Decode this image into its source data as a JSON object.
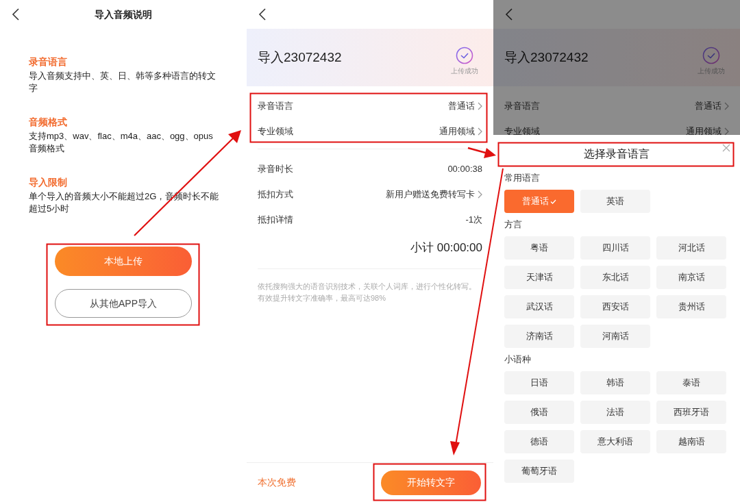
{
  "import_guide": {
    "title": "导入音频说明",
    "sections": [
      {
        "heading": "录音语言",
        "body": "导入音频支持中、英、日、韩等多种语言的转文字"
      },
      {
        "heading": "音频格式",
        "body": "支持mp3、wav、flac、m4a、aac、ogg、opus音频格式"
      },
      {
        "heading": "导入限制",
        "body": "单个导入的音频大小不能超过2G，音频时长不能超过5小时"
      }
    ],
    "buttons": [
      {
        "label": "本地上传",
        "kind": "primary"
      },
      {
        "label": "从其他APP导入",
        "kind": "outline"
      }
    ]
  },
  "import_detail": {
    "title": "导入23072432",
    "status": "上传成功",
    "settings": [
      {
        "label": "录音语言",
        "value": "普通话",
        "has_chevron": true
      },
      {
        "label": "专业领域",
        "value": "通用领域",
        "has_chevron": true
      }
    ],
    "details": [
      {
        "label": "录音时长",
        "value": "00:00:38",
        "has_chevron": false
      },
      {
        "label": "抵扣方式",
        "value": "新用户赠送免费转写卡",
        "has_chevron": true
      },
      {
        "label": "抵扣详情",
        "value": "-1次",
        "has_chevron": false
      }
    ],
    "subtotal": "小计 00:00:00",
    "note": "依托搜狗强大的语音识别技术，关联个人词库，进行个性化转写。有效提升转文字准确率，最高可达98%",
    "footer": {
      "price_label": "本次免费",
      "button": "开始转文字"
    }
  },
  "language_picker": {
    "background": {
      "title": "导入23072432",
      "status": "上传成功",
      "rows": [
        {
          "label": "录音语言",
          "value": "普通话",
          "has_chevron": true
        },
        {
          "label": "专业领域",
          "value": "通用领域",
          "has_chevron": true
        }
      ]
    },
    "sheet": {
      "title": "选择录音语言",
      "groups": [
        {
          "heading": "常用语言",
          "options": [
            {
              "label": "普通话",
              "selected": true
            },
            {
              "label": "英语",
              "selected": false
            }
          ]
        },
        {
          "heading": "方言",
          "options": [
            {
              "label": "粤语",
              "selected": false
            },
            {
              "label": "四川话",
              "selected": false
            },
            {
              "label": "河北话",
              "selected": false
            },
            {
              "label": "天津话",
              "selected": false
            },
            {
              "label": "东北话",
              "selected": false
            },
            {
              "label": "南京话",
              "selected": false
            },
            {
              "label": "武汉话",
              "selected": false
            },
            {
              "label": "西安话",
              "selected": false
            },
            {
              "label": "贵州话",
              "selected": false
            },
            {
              "label": "济南话",
              "selected": false
            },
            {
              "label": "河南话",
              "selected": false
            }
          ]
        },
        {
          "heading": "小语种",
          "options": [
            {
              "label": "日语",
              "selected": false
            },
            {
              "label": "韩语",
              "selected": false
            },
            {
              "label": "泰语",
              "selected": false
            },
            {
              "label": "俄语",
              "selected": false
            },
            {
              "label": "法语",
              "selected": false
            },
            {
              "label": "西班牙语",
              "selected": false
            },
            {
              "label": "德语",
              "selected": false
            },
            {
              "label": "意大利语",
              "selected": false
            },
            {
              "label": "越南语",
              "selected": false
            },
            {
              "label": "葡萄牙语",
              "selected": false
            }
          ]
        }
      ]
    }
  }
}
